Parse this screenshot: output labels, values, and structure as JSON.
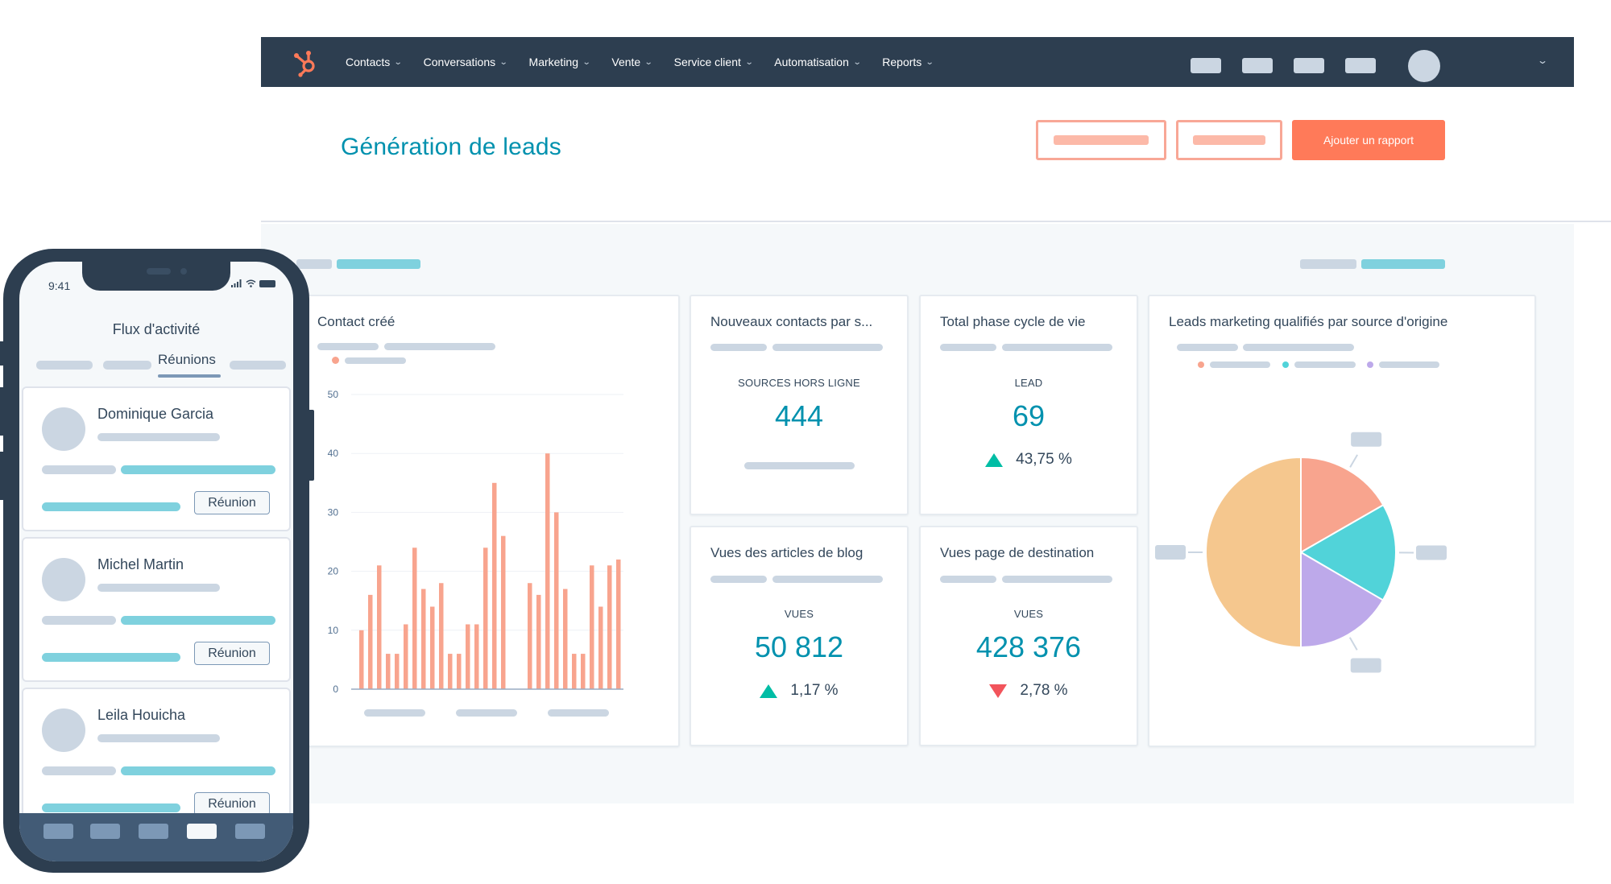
{
  "nav": {
    "logo": "hubspot-sprocket-logo",
    "items": [
      {
        "label": "Contacts",
        "icon": "chevron-down-icon"
      },
      {
        "label": "Conversations",
        "icon": "chevron-down-icon"
      },
      {
        "label": "Marketing",
        "icon": "chevron-down-icon"
      },
      {
        "label": "Vente",
        "icon": "chevron-down-icon"
      },
      {
        "label": "Service client",
        "icon": "chevron-down-icon"
      },
      {
        "label": "Automatisation",
        "icon": "chevron-down-icon"
      },
      {
        "label": "Reports",
        "icon": "chevron-down-icon"
      }
    ],
    "chevron_glyph": "⌄",
    "account_caret_glyph": "⌄"
  },
  "header": {
    "title": "Génération de leads",
    "primary_button": "Ajouter un rapport"
  },
  "colors": {
    "nav_bg": "#2d3e50",
    "accent_orange": "#ff7a59",
    "title_teal": "#0091ae",
    "bar_salmon": "#f8a48e",
    "up_green": "#00bda5",
    "down_red": "#f2545b"
  },
  "cards": {
    "contact_cree": {
      "title": "Contact créé"
    },
    "nouveaux_contacts": {
      "title": "Nouveaux contacts par s...",
      "label": "SOURCES HORS LIGNE",
      "value": "444"
    },
    "total_phase": {
      "title": "Total phase cycle de vie",
      "label": "LEAD",
      "value": "69",
      "change": "43,75 %",
      "direction": "up"
    },
    "vues_blog": {
      "title": "Vues des articles de blog",
      "label": "VUES",
      "value": "50 812",
      "change": "1,17 %",
      "direction": "up"
    },
    "vues_page": {
      "title": "Vues page de destination",
      "label": "VUES",
      "value": "428 376",
      "change": "2,78 %",
      "direction": "down"
    },
    "leads_mql": {
      "title": "Leads marketing qualifiés par source d'origine"
    }
  },
  "chart_data": [
    {
      "type": "bar",
      "title": "Contact créé",
      "xlabel": "",
      "ylabel": "",
      "ylim": [
        0,
        50
      ],
      "yticks": [
        "0",
        "10",
        "20",
        "30",
        "40",
        "50"
      ],
      "grid": true,
      "color": "#f8a48e",
      "values": [
        10,
        16,
        21,
        6,
        6,
        11,
        24,
        17,
        14,
        18,
        6,
        6,
        11,
        11,
        24,
        35,
        26,
        null,
        null,
        18,
        16,
        40,
        30,
        17,
        6,
        6,
        21,
        14,
        21,
        22
      ]
    },
    {
      "type": "pie",
      "title": "Leads marketing qualifiés par source d'origine",
      "slices": [
        {
          "color": "#f8a48e",
          "value": 16.7
        },
        {
          "color": "#51d3d9",
          "value": 16.7
        },
        {
          "color": "#bda9ea",
          "value": 16.6
        },
        {
          "color": "#f5c78e",
          "value": 50
        }
      ]
    }
  ],
  "phone": {
    "time": "9:41",
    "status_icons": "signal wifi battery",
    "title": "Flux d'activité",
    "active_tab": "Réunions",
    "feed": [
      {
        "name": "Dominique Garcia",
        "action": "Réunion"
      },
      {
        "name": "Michel Martin",
        "action": "Réunion"
      },
      {
        "name": "Leila Houicha",
        "action": "Réunion"
      }
    ]
  }
}
